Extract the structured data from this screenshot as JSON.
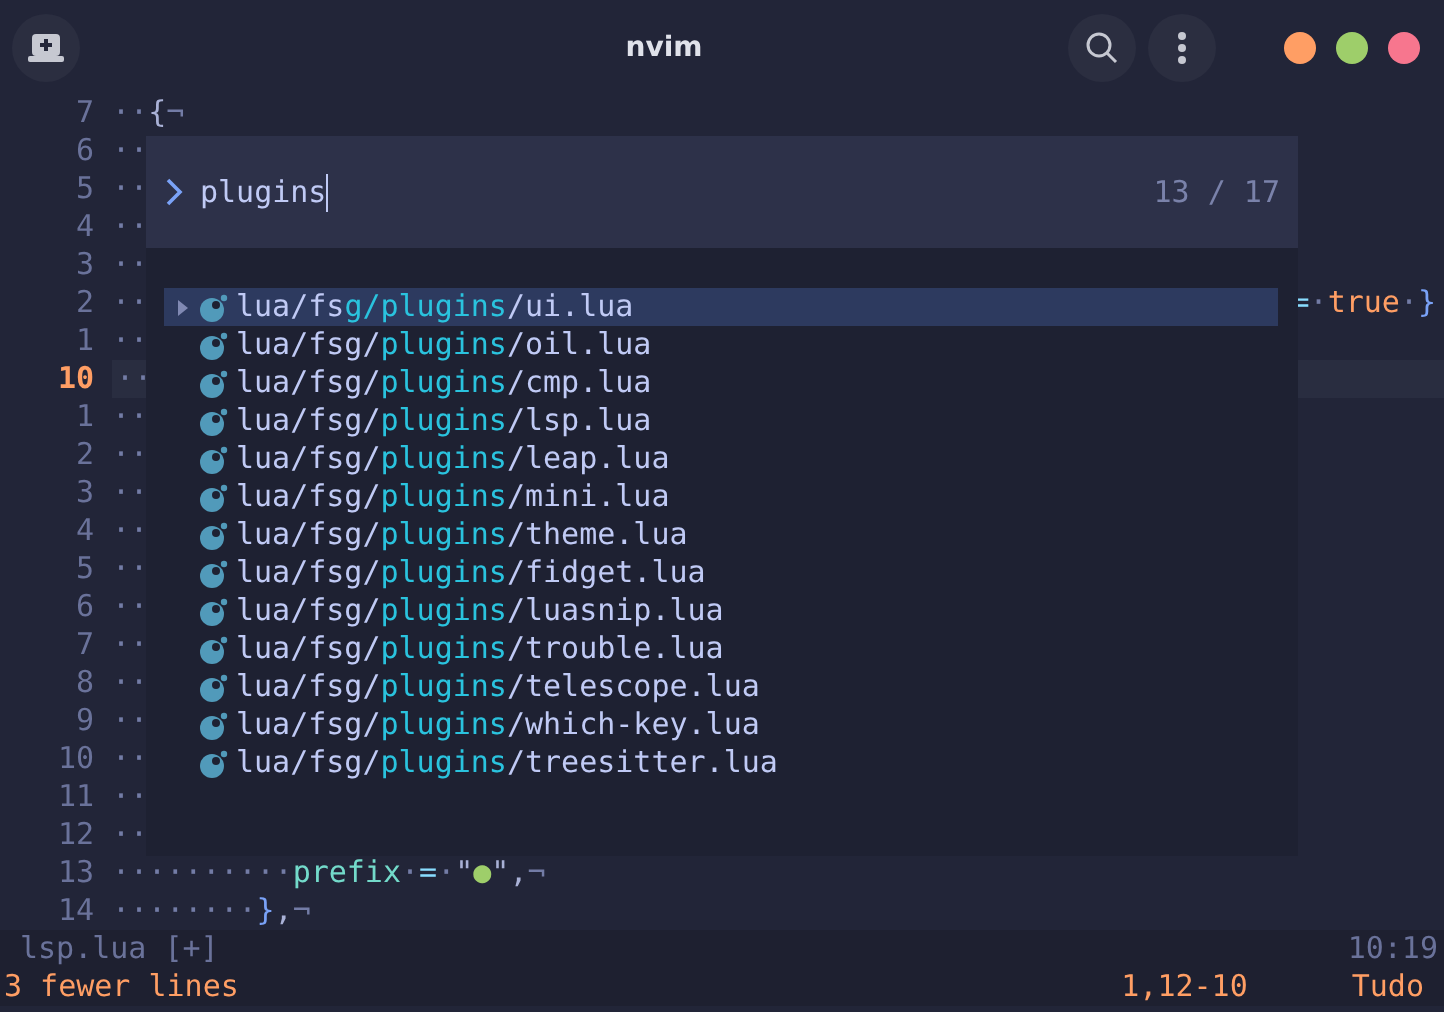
{
  "window": {
    "title": "nvim"
  },
  "editor": {
    "lines": [
      {
        "number": "7",
        "current": false,
        "segments": [
          {
            "text": "··",
            "kind": "ws"
          },
          {
            "text": "{",
            "kind": "punct"
          },
          {
            "text": "¬",
            "kind": "ws"
          }
        ]
      },
      {
        "number": "6",
        "current": false,
        "segments": [
          {
            "text": "··",
            "kind": "ws"
          }
        ]
      },
      {
        "number": "5",
        "current": false,
        "segments": [
          {
            "text": "··",
            "kind": "ws"
          }
        ]
      },
      {
        "number": "4",
        "current": false,
        "segments": [
          {
            "text": "··",
            "kind": "ws"
          }
        ]
      },
      {
        "number": "3",
        "current": false,
        "segments": [
          {
            "text": "··",
            "kind": "ws"
          }
        ]
      },
      {
        "number": "2",
        "current": false,
        "segments": [
          {
            "text": "··",
            "kind": "ws"
          }
        ],
        "tail": [
          {
            "text": "=",
            "kind": "operator"
          },
          {
            "text": "·",
            "kind": "ws"
          },
          {
            "text": "true",
            "kind": "boolean"
          },
          {
            "text": "·",
            "kind": "ws"
          },
          {
            "text": "}",
            "kind": "bracket"
          }
        ]
      },
      {
        "number": "1",
        "current": false,
        "segments": [
          {
            "text": "··",
            "kind": "ws"
          }
        ]
      },
      {
        "number": "10",
        "current": true,
        "segments": [
          {
            "text": "··",
            "kind": "ws"
          }
        ]
      },
      {
        "number": "1",
        "current": false,
        "segments": [
          {
            "text": "··",
            "kind": "ws"
          }
        ]
      },
      {
        "number": "2",
        "current": false,
        "segments": [
          {
            "text": "··",
            "kind": "ws"
          }
        ]
      },
      {
        "number": "3",
        "current": false,
        "segments": [
          {
            "text": "··",
            "kind": "ws"
          }
        ]
      },
      {
        "number": "4",
        "current": false,
        "segments": [
          {
            "text": "··",
            "kind": "ws"
          }
        ]
      },
      {
        "number": "5",
        "current": false,
        "segments": [
          {
            "text": "··",
            "kind": "ws"
          }
        ]
      },
      {
        "number": "6",
        "current": false,
        "segments": [
          {
            "text": "··",
            "kind": "ws"
          }
        ]
      },
      {
        "number": "7",
        "current": false,
        "segments": [
          {
            "text": "··",
            "kind": "ws"
          }
        ]
      },
      {
        "number": "8",
        "current": false,
        "segments": [
          {
            "text": "··",
            "kind": "ws"
          }
        ]
      },
      {
        "number": "9",
        "current": false,
        "segments": [
          {
            "text": "··",
            "kind": "ws"
          }
        ]
      },
      {
        "number": "10",
        "current": false,
        "segments": [
          {
            "text": "··",
            "kind": "ws"
          }
        ]
      },
      {
        "number": "11",
        "current": false,
        "segments": [
          {
            "text": "··",
            "kind": "ws"
          }
        ]
      },
      {
        "number": "12",
        "current": false,
        "segments": [
          {
            "text": "··",
            "kind": "ws"
          }
        ]
      },
      {
        "number": "13",
        "current": false,
        "segments": [
          {
            "text": "··········",
            "kind": "ws"
          },
          {
            "text": "prefix",
            "kind": "field"
          },
          {
            "text": "·",
            "kind": "ws"
          },
          {
            "text": "=",
            "kind": "operator"
          },
          {
            "text": "·",
            "kind": "ws"
          },
          {
            "text": "\"",
            "kind": "punct"
          },
          {
            "text": "●",
            "kind": "string"
          },
          {
            "text": "\"",
            "kind": "punct"
          },
          {
            "text": ",",
            "kind": "punct"
          },
          {
            "text": "¬",
            "kind": "ws"
          }
        ]
      },
      {
        "number": "14",
        "current": false,
        "segments": [
          {
            "text": "········",
            "kind": "ws"
          },
          {
            "text": "}",
            "kind": "bracket"
          },
          {
            "text": ",",
            "kind": "punct"
          },
          {
            "text": "¬",
            "kind": "ws"
          }
        ]
      }
    ]
  },
  "picker": {
    "prompt": {
      "value": "plugins",
      "counter": "13 / 17"
    },
    "results": [
      {
        "selected": true,
        "parts": [
          {
            "text": "lua/fs",
            "match": false
          },
          {
            "text": "g/plugins",
            "match": true
          },
          {
            "text": "/ui.lua",
            "match": false
          }
        ]
      },
      {
        "selected": false,
        "parts": [
          {
            "text": "lua/fsg/",
            "match": false
          },
          {
            "text": "plugins",
            "match": true
          },
          {
            "text": "/oil.lua",
            "match": false
          }
        ]
      },
      {
        "selected": false,
        "parts": [
          {
            "text": "lua/fsg/",
            "match": false
          },
          {
            "text": "plugins",
            "match": true
          },
          {
            "text": "/cmp.lua",
            "match": false
          }
        ]
      },
      {
        "selected": false,
        "parts": [
          {
            "text": "lua/fsg/",
            "match": false
          },
          {
            "text": "plugins",
            "match": true
          },
          {
            "text": "/lsp.lua",
            "match": false
          }
        ]
      },
      {
        "selected": false,
        "parts": [
          {
            "text": "lua/fsg/",
            "match": false
          },
          {
            "text": "plugins",
            "match": true
          },
          {
            "text": "/leap.lua",
            "match": false
          }
        ]
      },
      {
        "selected": false,
        "parts": [
          {
            "text": "lua/fsg/",
            "match": false
          },
          {
            "text": "plugins",
            "match": true
          },
          {
            "text": "/mini.lua",
            "match": false
          }
        ]
      },
      {
        "selected": false,
        "parts": [
          {
            "text": "lua/fsg/",
            "match": false
          },
          {
            "text": "plugins",
            "match": true
          },
          {
            "text": "/theme.lua",
            "match": false
          }
        ]
      },
      {
        "selected": false,
        "parts": [
          {
            "text": "lua/fsg/",
            "match": false
          },
          {
            "text": "plugins",
            "match": true
          },
          {
            "text": "/fidget.lua",
            "match": false
          }
        ]
      },
      {
        "selected": false,
        "parts": [
          {
            "text": "lua/fsg/",
            "match": false
          },
          {
            "text": "plugins",
            "match": true
          },
          {
            "text": "/luasnip.lua",
            "match": false
          }
        ]
      },
      {
        "selected": false,
        "parts": [
          {
            "text": "lua/fsg/",
            "match": false
          },
          {
            "text": "plugins",
            "match": true
          },
          {
            "text": "/trouble.lua",
            "match": false
          }
        ]
      },
      {
        "selected": false,
        "parts": [
          {
            "text": "lua/fsg/",
            "match": false
          },
          {
            "text": "plugins",
            "match": true
          },
          {
            "text": "/telescope.lua",
            "match": false
          }
        ]
      },
      {
        "selected": false,
        "parts": [
          {
            "text": "lua/fsg/",
            "match": false
          },
          {
            "text": "plugins",
            "match": true
          },
          {
            "text": "/which-key.lua",
            "match": false
          }
        ]
      },
      {
        "selected": false,
        "parts": [
          {
            "text": "lua/fsg/",
            "match": false
          },
          {
            "text": "plugins",
            "match": true
          },
          {
            "text": "/treesitter.lua",
            "match": false
          }
        ]
      }
    ]
  },
  "status_line": {
    "file": "lsp.lua [+]",
    "time": "10:19"
  },
  "command_line": {
    "message": "3 fewer lines",
    "position": "1,12-10",
    "scroll": "Tudo"
  }
}
